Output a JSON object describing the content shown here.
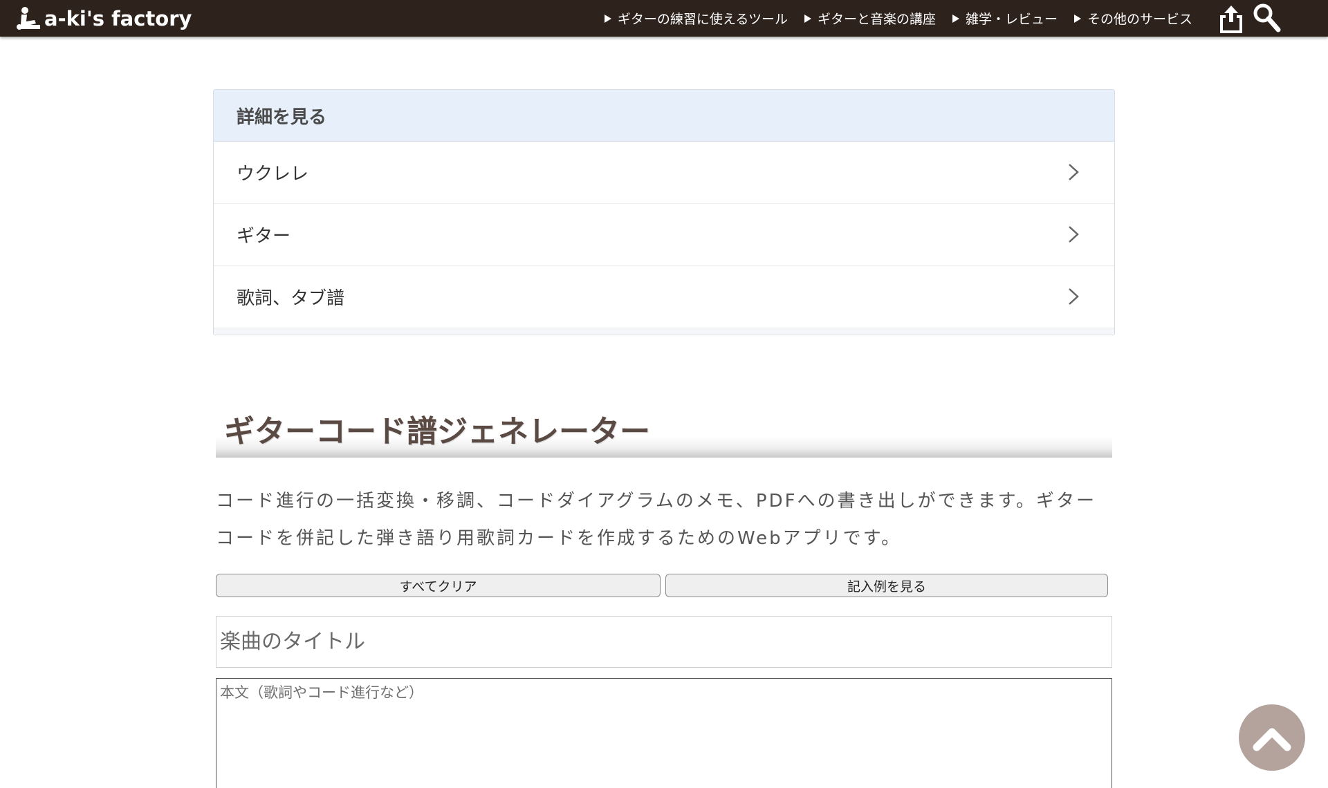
{
  "header": {
    "logo_text": "a-ki's factory",
    "nav": [
      {
        "label": "ギターの練習に使えるツール"
      },
      {
        "label": "ギターと音楽の講座"
      },
      {
        "label": "雑学・レビュー"
      },
      {
        "label": "その他のサービス"
      }
    ],
    "icons": {
      "share": "share-icon",
      "search": "search-icon"
    }
  },
  "details": {
    "heading": "詳細を見る",
    "items": [
      {
        "label": "ウクレレ"
      },
      {
        "label": "ギター"
      },
      {
        "label": "歌詞、タブ譜"
      }
    ]
  },
  "main": {
    "title": "ギターコード譜ジェネレーター",
    "description": "コード進行の一括変換・移調、コードダイアグラムのメモ、PDFへの書き出しができます。ギターコードを併記した弾き語り用歌詞カードを作成するためのWebアプリです。",
    "clear_button": "すべてクリア",
    "example_button": "記入例を見る",
    "title_placeholder": "楽曲のタイトル",
    "body_placeholder": "本文（歌詞やコード進行など）"
  },
  "colors": {
    "header_bg": "#2e221c",
    "details_head_bg": "#e7effb",
    "heading_text": "#5b4a44",
    "totop_bg": "#b4a39d"
  }
}
